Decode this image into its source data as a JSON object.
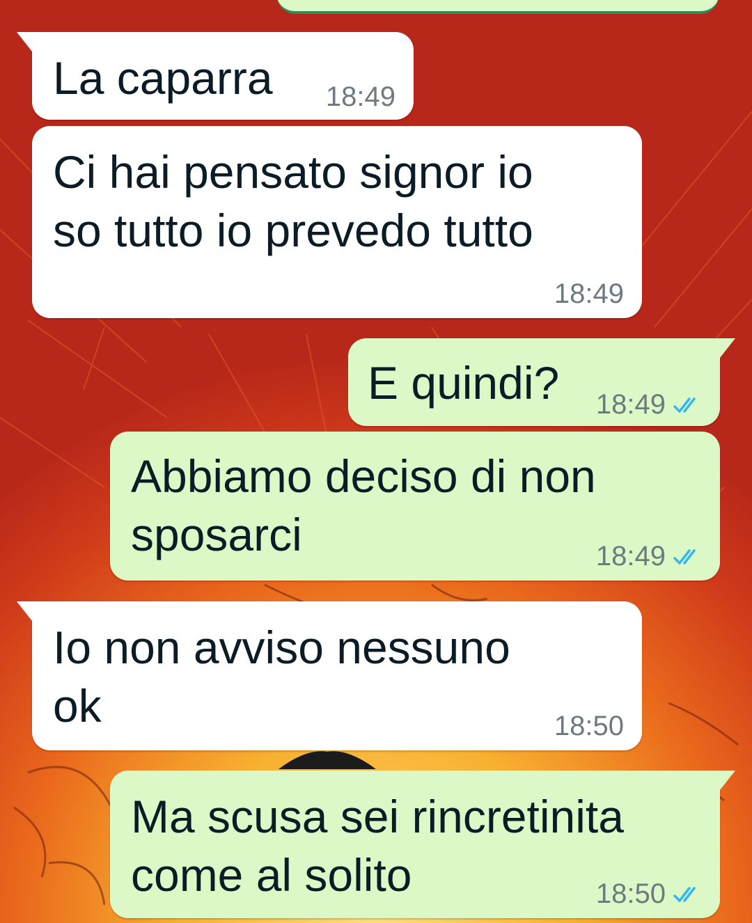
{
  "messages": [
    {
      "direction": "in",
      "lines": "La caparra",
      "time": "18:49",
      "read": false
    },
    {
      "direction": "in",
      "lines": "Ci hai pensato signor io\nso tutto io prevedo tutto",
      "time": "18:49",
      "read": false
    },
    {
      "direction": "out",
      "lines": "E quindi?",
      "time": "18:49",
      "read": true
    },
    {
      "direction": "out",
      "lines": "Abbiamo deciso di non\nsposarci",
      "time": "18:49",
      "read": true
    },
    {
      "direction": "in",
      "lines": "Io non avviso nessuno\nok",
      "time": "18:50",
      "read": false
    },
    {
      "direction": "out",
      "lines": "Ma scusa sei rincretinita\ncome al solito",
      "time": "18:50",
      "read": true
    }
  ],
  "icons": {
    "read_receipt": "double-check-icon"
  },
  "colors": {
    "incoming_bubble": "#ffffff",
    "outgoing_bubble": "#dcf8c6",
    "text": "#0b1c26",
    "timestamp": "#6d7a80",
    "read_ticks": "#34b7f1",
    "wallpaper_red": "#c8321c",
    "wallpaper_orange": "#f39a1e"
  }
}
